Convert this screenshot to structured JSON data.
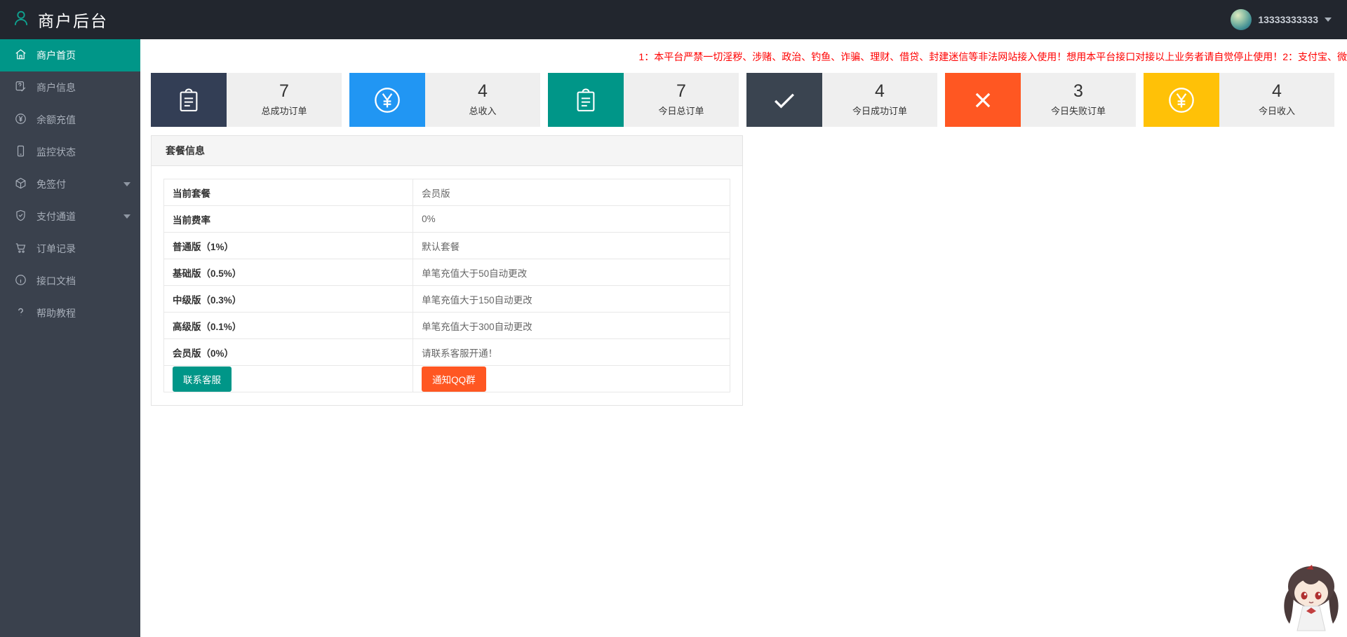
{
  "theme": {
    "accent": "#009688",
    "navbar_bg": "#22262e",
    "sidebar_bg": "#3a414d",
    "notice_color": "#ff0000"
  },
  "navbar": {
    "title": "商户后台",
    "logo_icon": "person-icon",
    "username": "13333333333",
    "caret_icon": "chevron-down-icon"
  },
  "sidebar": {
    "items": [
      {
        "label": "商户首页",
        "icon": "home-icon",
        "active": true
      },
      {
        "label": "商户信息",
        "icon": "merchant-info-icon"
      },
      {
        "label": "余额充值",
        "icon": "recharge-yen-icon"
      },
      {
        "label": "监控状态",
        "icon": "monitor-icon"
      },
      {
        "label": "免签付",
        "icon": "cube-icon",
        "expandable": true
      },
      {
        "label": "支付通道",
        "icon": "shield-icon",
        "expandable": true
      },
      {
        "label": "订单记录",
        "icon": "cart-icon"
      },
      {
        "label": "接口文档",
        "icon": "info-icon"
      },
      {
        "label": "帮助教程",
        "icon": "question-icon"
      }
    ]
  },
  "notice": "1：本平台严禁一切淫秽、涉赌、政治、钓鱼、诈骗、理财、借贷、封建迷信等非法网站接入使用！想用本平台接口对接以上业务者请自觉停止使用！2：支付宝、微",
  "stats": {
    "cards": [
      {
        "icon": "clipboard-icon",
        "color": "#333e55",
        "value": "7",
        "label": "总成功订单"
      },
      {
        "icon": "yen-icon",
        "color": "#2196f3",
        "value": "4",
        "label": "总收入"
      },
      {
        "icon": "clipboard-icon",
        "color": "#009688",
        "value": "7",
        "label": "今日总订单"
      },
      {
        "icon": "check-icon",
        "color": "#3a4450",
        "value": "4",
        "label": "今日成功订单"
      },
      {
        "icon": "close-icon",
        "color": "#ff5722",
        "value": "3",
        "label": "今日失败订单"
      },
      {
        "icon": "yen-icon",
        "color": "#ffc107",
        "value": "4",
        "label": "今日收入"
      }
    ]
  },
  "package_panel": {
    "title": "套餐信息",
    "rows": [
      {
        "label": "当前套餐",
        "value": "会员版",
        "red": true
      },
      {
        "label": "当前费率",
        "value": "0%",
        "red": true
      },
      {
        "label": "普通版（1%）",
        "value": "默认套餐"
      },
      {
        "label": "基础版（0.5%）",
        "value": "单笔充值大于50自动更改"
      },
      {
        "label": "中级版（0.3%）",
        "value": "单笔充值大于150自动更改"
      },
      {
        "label": "高级版（0.1%）",
        "value": "单笔充值大于300自动更改"
      },
      {
        "label": "会员版（0%）",
        "value": "请联系客服开通！"
      }
    ],
    "buttons": [
      {
        "label": "联系客服",
        "color": "#009688"
      },
      {
        "label": "通知QQ群",
        "color": "#ff5722"
      }
    ]
  }
}
